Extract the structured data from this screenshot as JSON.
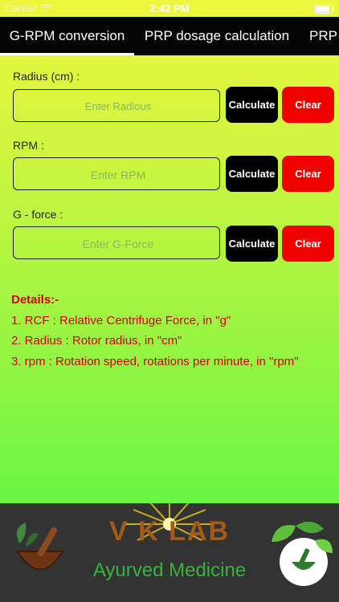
{
  "status_bar": {
    "carrier": "Carrier",
    "time": "2:42 PM"
  },
  "tabs": [
    {
      "label": "G-RPM conversion",
      "active": true
    },
    {
      "label": "PRP dosage calculation",
      "active": false
    },
    {
      "label": "PRP c",
      "active": false
    }
  ],
  "form": {
    "radius": {
      "label": "Radius (cm) :",
      "placeholder": "Enter Radious"
    },
    "rpm": {
      "label": "RPM :",
      "placeholder": "Enter RPM"
    },
    "gforce": {
      "label": "G - force :",
      "placeholder": "Enter G-Force"
    },
    "calculate_label": "Calculate",
    "clear_label": "Clear"
  },
  "details": {
    "title": "Details:-",
    "items": [
      "1.  RCF : Relative Centrifuge Force, in \"g\"",
      "2.  Radius : Rotor radius, in \"cm\"",
      "3.  rpm : Rotation speed, rotations per minute, in \"rpm\""
    ]
  },
  "banner": {
    "brand": "V K LAB",
    "tagline": "Ayurved Medicine"
  },
  "colors": {
    "accent_red": "#d40000",
    "clear_button": "#f20000",
    "brand_brown": "#a15c1c",
    "tagline_green": "#34b43b"
  },
  "icons": [
    "wifi-icon",
    "battery-icon",
    "mortar-pestle-icon",
    "leaf-icon",
    "sunburst-icon"
  ]
}
